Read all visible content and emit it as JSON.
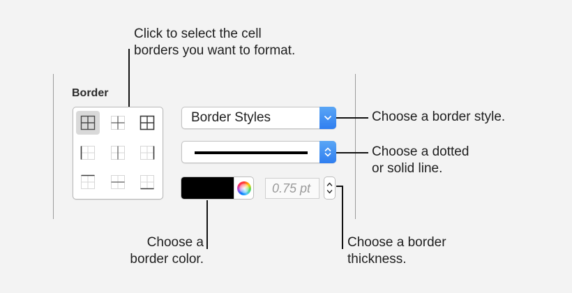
{
  "panel": {
    "title": "Border"
  },
  "border_grid": {
    "cells": [
      {
        "name": "all-borders-icon",
        "selected": true
      },
      {
        "name": "inside-borders-icon",
        "selected": false
      },
      {
        "name": "outside-borders-icon",
        "selected": false
      },
      {
        "name": "left-border-icon",
        "selected": false
      },
      {
        "name": "inside-vertical-borders-icon",
        "selected": false
      },
      {
        "name": "right-border-icon",
        "selected": false
      },
      {
        "name": "bottom-border-icon",
        "selected": false
      },
      {
        "name": "inside-horizontal-borders-icon",
        "selected": false
      },
      {
        "name": "top-border-icon",
        "selected": false
      }
    ]
  },
  "style_popup": {
    "label": "Border Styles"
  },
  "line_popup": {
    "line_style": "solid"
  },
  "color": {
    "value": "#000000"
  },
  "thickness": {
    "value": "0.75 pt"
  },
  "callouts": {
    "grid_line1": "Click to select the cell",
    "grid_line2": "borders you want to format.",
    "style": "Choose a border style.",
    "line_line1": "Choose a dotted",
    "line_line2": "or solid line.",
    "color_line1": "Choose a",
    "color_line2": "border color.",
    "thickness_line1": "Choose a border",
    "thickness_line2": "thickness."
  }
}
